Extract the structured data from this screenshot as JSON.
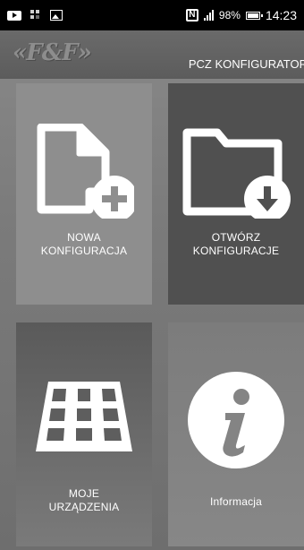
{
  "status_bar": {
    "battery": "98%",
    "time": "14:23"
  },
  "app": {
    "logo": "«F&F»",
    "title": "PCZ KONFIGURATOR"
  },
  "tiles": [
    {
      "line1": "NOWA",
      "line2": "KONFIGURACJA",
      "icon": "new-file-plus-icon"
    },
    {
      "line1": "OTWÓRZ",
      "line2": "KONFIGURACJE",
      "icon": "folder-download-icon"
    },
    {
      "line1": "MOJE",
      "line2": "URZĄDZENIA",
      "icon": "device-grid-icon"
    },
    {
      "line1": "Informacja",
      "line2": "",
      "icon": "info-icon"
    }
  ],
  "colors": {
    "status_bar": "#000000",
    "tile_light": "#8e8e8e",
    "tile_dark": "#505050",
    "icon": "#ffffff"
  }
}
